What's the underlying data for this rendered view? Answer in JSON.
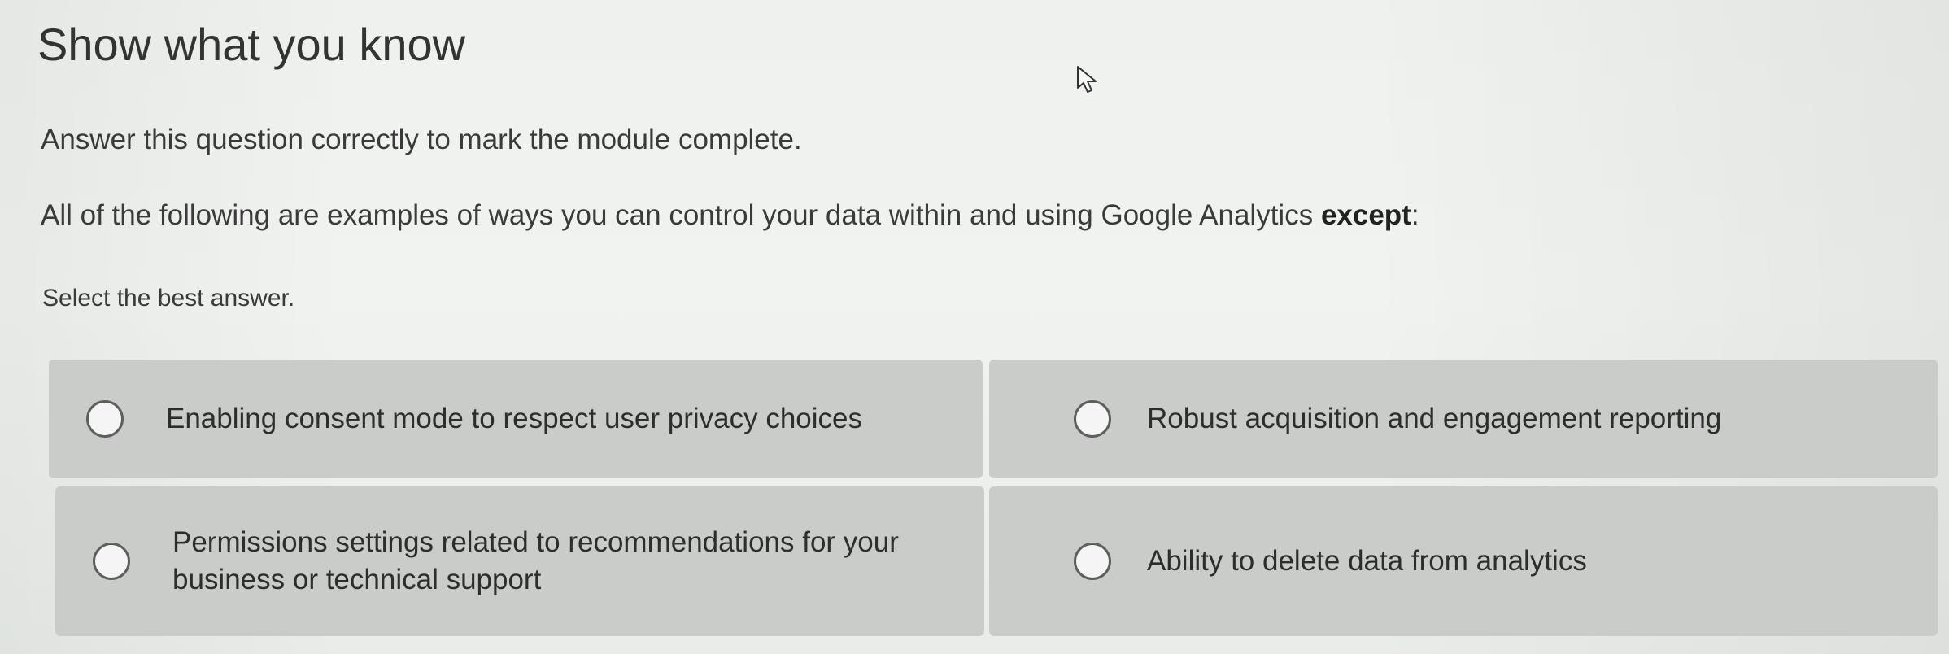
{
  "header": {
    "title": "Show what you know"
  },
  "content": {
    "intro": "Answer this question correctly to mark the module complete.",
    "question_main": "All of the following are examples of ways you can control your data within and using Google Analytics ",
    "question_emphasis": "except",
    "question_end": ":",
    "instruction": "Select the best answer."
  },
  "options": [
    {
      "label": "Enabling consent mode to respect user privacy choices"
    },
    {
      "label": "Robust acquisition and engagement reporting"
    },
    {
      "label": "Permissions settings related to recommendations for your business or technical support"
    },
    {
      "label": "Ability to delete data from analytics"
    }
  ],
  "icons": {
    "cursor": "mouse-pointer-icon",
    "radio": "radio-button-icon"
  },
  "colors": {
    "option_background": "#c9ccc9",
    "text": "#2d2d2d"
  }
}
